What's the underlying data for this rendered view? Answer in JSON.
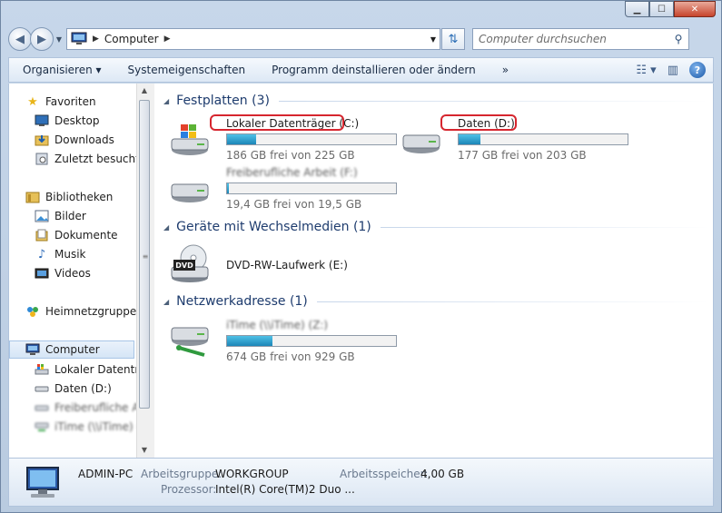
{
  "window": {
    "min_label": "▁",
    "max_label": "☐",
    "close_label": "✕"
  },
  "address": {
    "crumb": "Computer"
  },
  "search": {
    "placeholder": "Computer durchsuchen"
  },
  "toolbar": {
    "organize": "Organisieren ▾",
    "system_props": "Systemeigenschaften",
    "uninstall": "Programm deinstallieren oder ändern",
    "more": "»"
  },
  "sidebar": {
    "favorites": "Favoriten",
    "desktop": "Desktop",
    "downloads": "Downloads",
    "recent": "Zuletzt besucht",
    "libraries": "Bibliotheken",
    "pictures": "Bilder",
    "documents": "Dokumente",
    "music": "Musik",
    "videos": "Videos",
    "homegroup": "Heimnetzgruppe",
    "computer": "Computer",
    "local_disk": "Lokaler Datenträg",
    "data_d": "Daten (D:)",
    "blurred_1": "Freiberufliche Ar",
    "blurred_2": "iTime (\\\\iTime) (Z"
  },
  "groups": {
    "hdd": "Festplatten (3)",
    "removable": "Geräte mit Wechselmedien (1)",
    "network": "Netzwerkadresse (1)"
  },
  "drives": [
    {
      "name": "Lokaler Datenträger (C:)",
      "info": "186 GB frei von 225 GB",
      "used_fraction": 0.17
    },
    {
      "name": "Daten (D:)",
      "info": "177 GB frei von 203 GB",
      "used_fraction": 0.13
    },
    {
      "name": "Freiberufliche Arbeit (F:)",
      "info": "19,4 GB frei von 19,5 GB",
      "used_fraction": 0.01
    },
    {
      "name": "DVD-RW-Laufwerk (E:)"
    },
    {
      "name": "iTime (\\\\iTime) (Z:)",
      "info": "674 GB frei von 929 GB",
      "used_fraction": 0.27
    }
  ],
  "dvd_label": "DVD",
  "details": {
    "name": "ADMIN-PC",
    "workgroup_label": "Arbeitsgruppe:",
    "workgroup_value": "WORKGROUP",
    "memory_label": "Arbeitsspeicher:",
    "memory_value": "4,00 GB",
    "cpu_label": "Prozessor:",
    "cpu_value": "Intel(R) Core(TM)2 Duo ..."
  },
  "colors": {
    "accent": "#1e3c6e",
    "bar_fill": "#1c86b8",
    "callout": "#d6262f"
  }
}
